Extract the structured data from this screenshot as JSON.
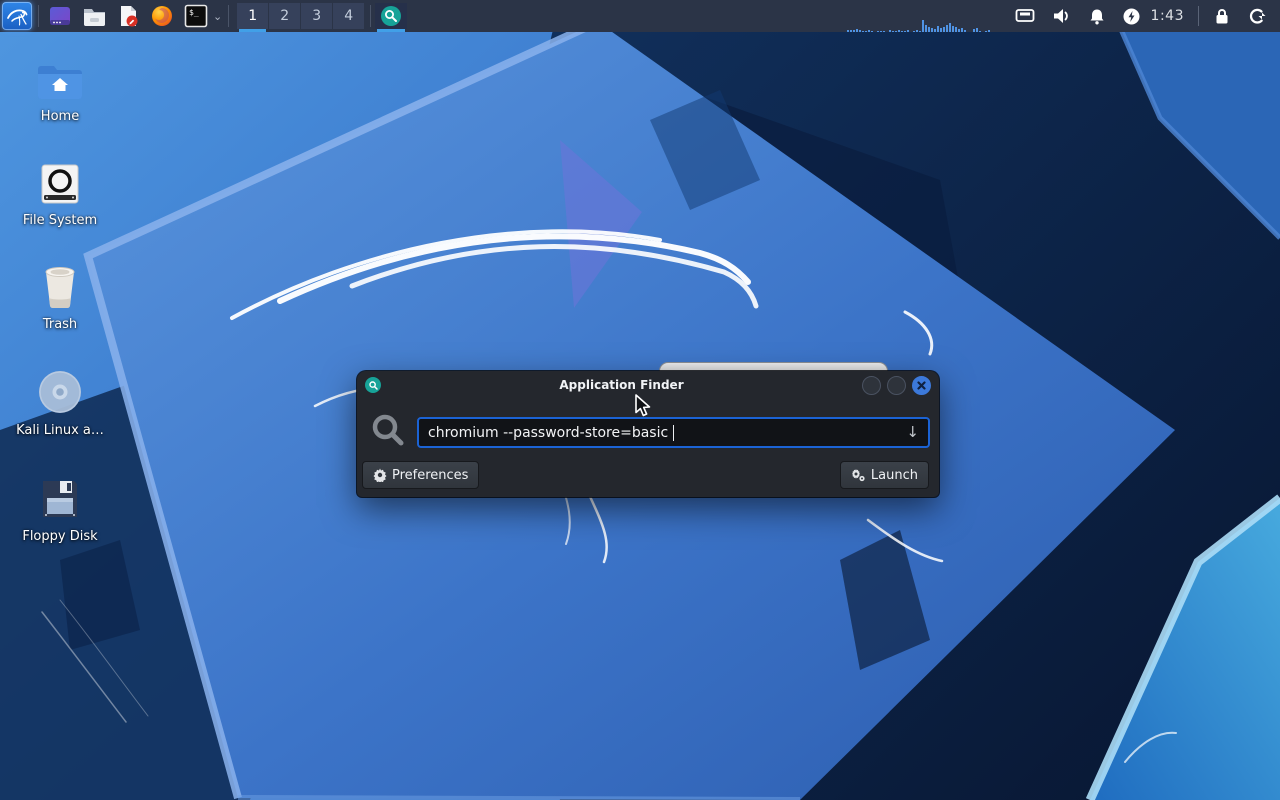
{
  "panel": {
    "workspaces": [
      "1",
      "2",
      "3",
      "4"
    ],
    "active_workspace": "1",
    "clock": "1:43",
    "launcher_icons": [
      "kali-menu",
      "window-manager",
      "file-manager",
      "text-editor",
      "firefox",
      "terminal"
    ],
    "tray_icons": [
      "network",
      "volume",
      "notifications",
      "power-manager",
      "screen-lock",
      "log-out"
    ],
    "cpu_graph": {
      "bars": [
        0,
        2,
        2,
        2,
        3,
        2,
        1,
        1,
        2,
        1,
        0,
        1,
        1,
        1,
        0,
        2,
        1,
        1,
        2,
        1,
        1,
        2,
        0,
        1,
        2,
        1,
        12,
        7,
        5,
        4,
        3,
        6,
        4,
        5,
        7,
        9,
        6,
        5,
        3,
        4,
        2,
        0,
        0,
        3,
        4,
        1,
        0,
        1,
        2,
        0
      ]
    }
  },
  "desktop": {
    "icons": [
      {
        "label": "Home"
      },
      {
        "label": "File System"
      },
      {
        "label": "Trash"
      },
      {
        "label": "Kali Linux a…"
      },
      {
        "label": "Floppy Disk"
      }
    ]
  },
  "finder": {
    "title": "Application Finder",
    "query": "chromium --password-store=basic",
    "dropdown_icon": "↓",
    "preferences_label": "Preferences",
    "launch_label": "Launch"
  },
  "colors": {
    "panel_bg": "#2b3447",
    "workspace_underline": "#41a0e8",
    "dialog_bg": "#24272d",
    "input_border": "#1b63d5",
    "close_button": "#3c79da",
    "finder_teal": "#17a398",
    "cpu_bar": "#4f93e4"
  }
}
